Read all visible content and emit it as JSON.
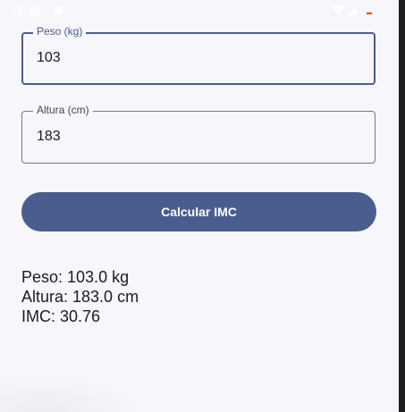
{
  "status_bar": {
    "time": "12:46",
    "icons": [
      "notification-dot-icon",
      "wifi-icon",
      "signal-icon",
      "battery-icon"
    ]
  },
  "form": {
    "weight": {
      "label": "Peso (kg)",
      "value": "103"
    },
    "height": {
      "label": "Altura (cm)",
      "value": "183"
    },
    "submit_label": "Calcular IMC"
  },
  "results": {
    "peso": "Peso: 103.0 kg",
    "altura": "Altura: 183.0 cm",
    "imc": "IMC: 30.76"
  },
  "colors": {
    "primary": "#4a5d8e",
    "background": "#f7f6fb",
    "outline": "#77777f",
    "text": "#1b1b21"
  }
}
